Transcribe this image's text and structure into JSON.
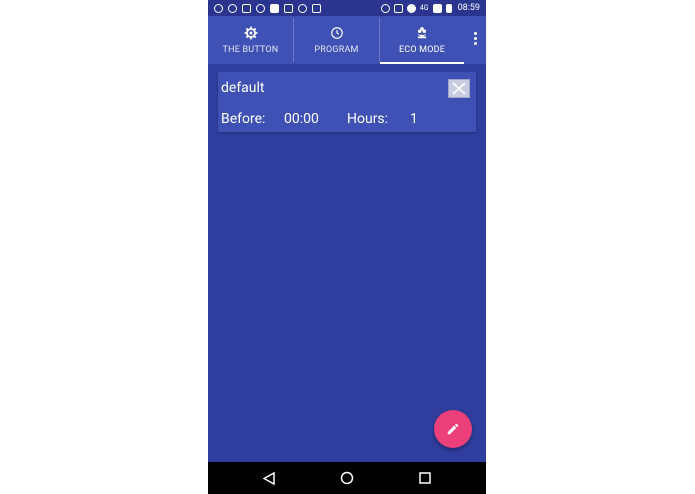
{
  "status_bar": {
    "time": "08:59",
    "network": "4G"
  },
  "tabs": [
    {
      "label": "THE BUTTON",
      "icon": "gear-icon"
    },
    {
      "label": "PROGRAM",
      "icon": "clock-icon"
    },
    {
      "label": "ECO MODE",
      "icon": "eco-flower-icon",
      "active": true
    }
  ],
  "card": {
    "name": "default",
    "before_label": "Before:",
    "before_value": "00:00",
    "hours_label": "Hours:",
    "hours_value": "1"
  },
  "colors": {
    "background": "#2f3e9e",
    "appbar": "#3f51b5",
    "fab": "#ec407a"
  }
}
